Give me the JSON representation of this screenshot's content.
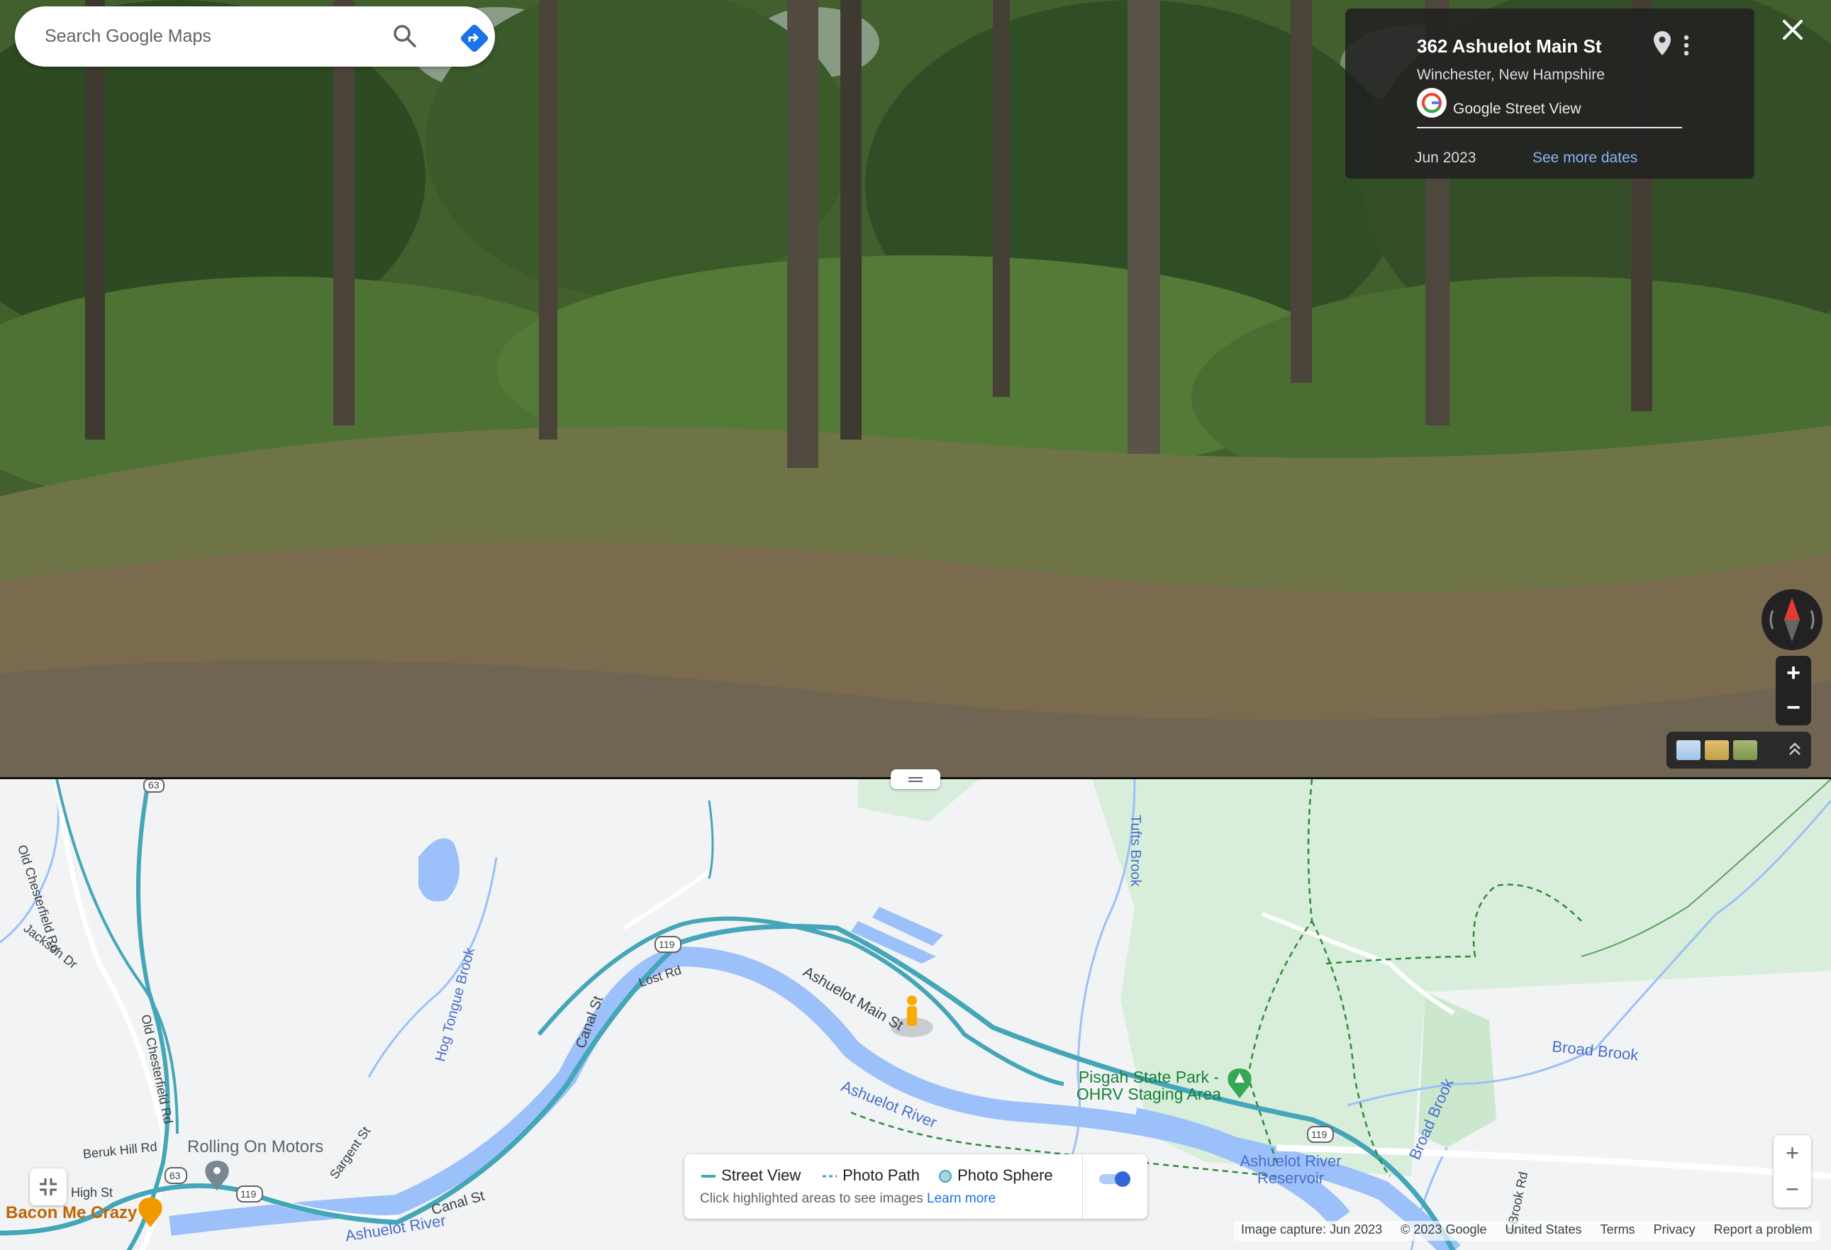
{
  "search": {
    "placeholder": "Search Google Maps"
  },
  "info_card": {
    "title": "362 Ashuelot Main St",
    "subtitle": "Winchester, New Hampshire",
    "source": "Google Street View",
    "date": "Jun 2023",
    "see_more_dates": "See more dates"
  },
  "map": {
    "road_labels": {
      "old_chesterfield_top": "Old Chesterfield Rd",
      "old_chesterfield_bottom": "Old Chesterfield Rd",
      "jackson_dr": "Jackson Dr",
      "lost_rd": "Lost Rd",
      "canal_st_upper": "Canal St",
      "canal_st_lower": "Canal St",
      "sargent_st": "Sargent St",
      "beruk_hill": "Beruk Hill Rd",
      "high_st": "High St",
      "ashuelot_main": "Ashuelot Main St",
      "broad_brook_rd": "d Brook Rd"
    },
    "water_labels": {
      "hog_tongue": "Hog Tongue Brook",
      "tufts_brook": "Tufts Brook",
      "ashuelot_river_mid": "Ashuelot River",
      "ashuelot_river_low": "Ashuelot River",
      "reservoir": "Ashuelot River Reservoir",
      "broad_brook_right": "Broad Brook",
      "broad_brook_vertical": "Broad Brook"
    },
    "park_label": "Pisgah State Park - OHRV Staging Area",
    "poi_labels": {
      "rolling_on_motors": "Rolling On Motors",
      "bacon_me_crazy": "Bacon Me Crazy"
    },
    "route_shields": {
      "r63_top": "63",
      "r119_upper": "119",
      "r63_low": "63",
      "r119_low": "119",
      "r119_right": "119"
    }
  },
  "legend": {
    "street_view": "Street View",
    "photo_path": "Photo Path",
    "photo_sphere": "Photo Sphere",
    "hint": "Click highlighted areas to see images",
    "learn_more": "Learn more"
  },
  "footer": {
    "image_capture": "Image capture: Jun 2023",
    "copyright": "© 2023 Google",
    "country": "United States",
    "terms": "Terms",
    "privacy": "Privacy",
    "report": "Report a problem"
  },
  "colors": {
    "street_view_line": "#44a6b8",
    "water": "#9cc0f9",
    "park": "#d6edd6",
    "toggle_on": "#3367d6"
  }
}
